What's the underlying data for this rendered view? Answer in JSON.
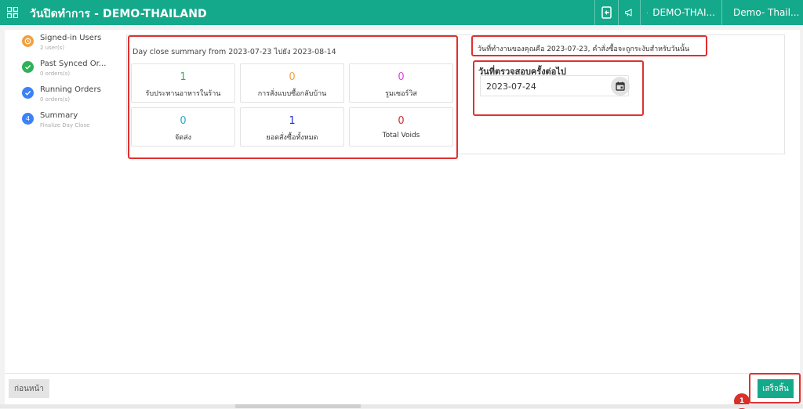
{
  "header": {
    "title": "วันปิดทำการ - DEMO-THAILAND",
    "store_label": "DEMO-THAI...",
    "user_label": "Demo- Thail..."
  },
  "steps": [
    {
      "title": "Signed-in Users",
      "sub": "2 user(s)",
      "status": "warning",
      "color": "#f0a040"
    },
    {
      "title": "Past Synced Or...",
      "sub": "0 orders(s)",
      "status": "done",
      "color": "#2fb05a"
    },
    {
      "title": "Running Orders",
      "sub": "0 orders(s)",
      "status": "done",
      "color": "#3b82f6"
    },
    {
      "title": "Summary",
      "sub": "Finalize Day Close",
      "status": "current",
      "number": "4",
      "color": "#3b82f6"
    }
  ],
  "summary": {
    "title": "Day close summary from 2023-07-23 ไปยัง 2023-08-14",
    "tiles": [
      {
        "value": "1",
        "label": "รับประทานอาหารในร้าน",
        "color": "#2fb05a"
      },
      {
        "value": "0",
        "label": "การสั่งแบบซื้อกลับบ้าน",
        "color": "#f0a040"
      },
      {
        "value": "0",
        "label": "รูมเซอร์วิส",
        "color": "#e040e0"
      },
      {
        "value": "0",
        "label": "จัดส่ง",
        "color": "#30a8c8"
      },
      {
        "value": "1",
        "label": "ยอดสั่งซื้อทั้งหมด",
        "color": "#2030d0"
      },
      {
        "value": "0",
        "label": "Total Voids",
        "color": "#d03030"
      }
    ]
  },
  "note": {
    "text": "วันที่ทำงานของคุณคือ 2023-07-23, คำสั่งซื้อจะถูกระงับสำหรับวันนั้น"
  },
  "next_check": {
    "label": "วันที่ตรวจสอบครั้งต่อไป",
    "date": "2023-07-24"
  },
  "footer": {
    "prev_label": "ก่อนหน้า",
    "finish_label": "เสร็จสิ้น",
    "badge": "1"
  },
  "colors": {
    "brand": "#14a98b",
    "highlight": "#e03030"
  }
}
